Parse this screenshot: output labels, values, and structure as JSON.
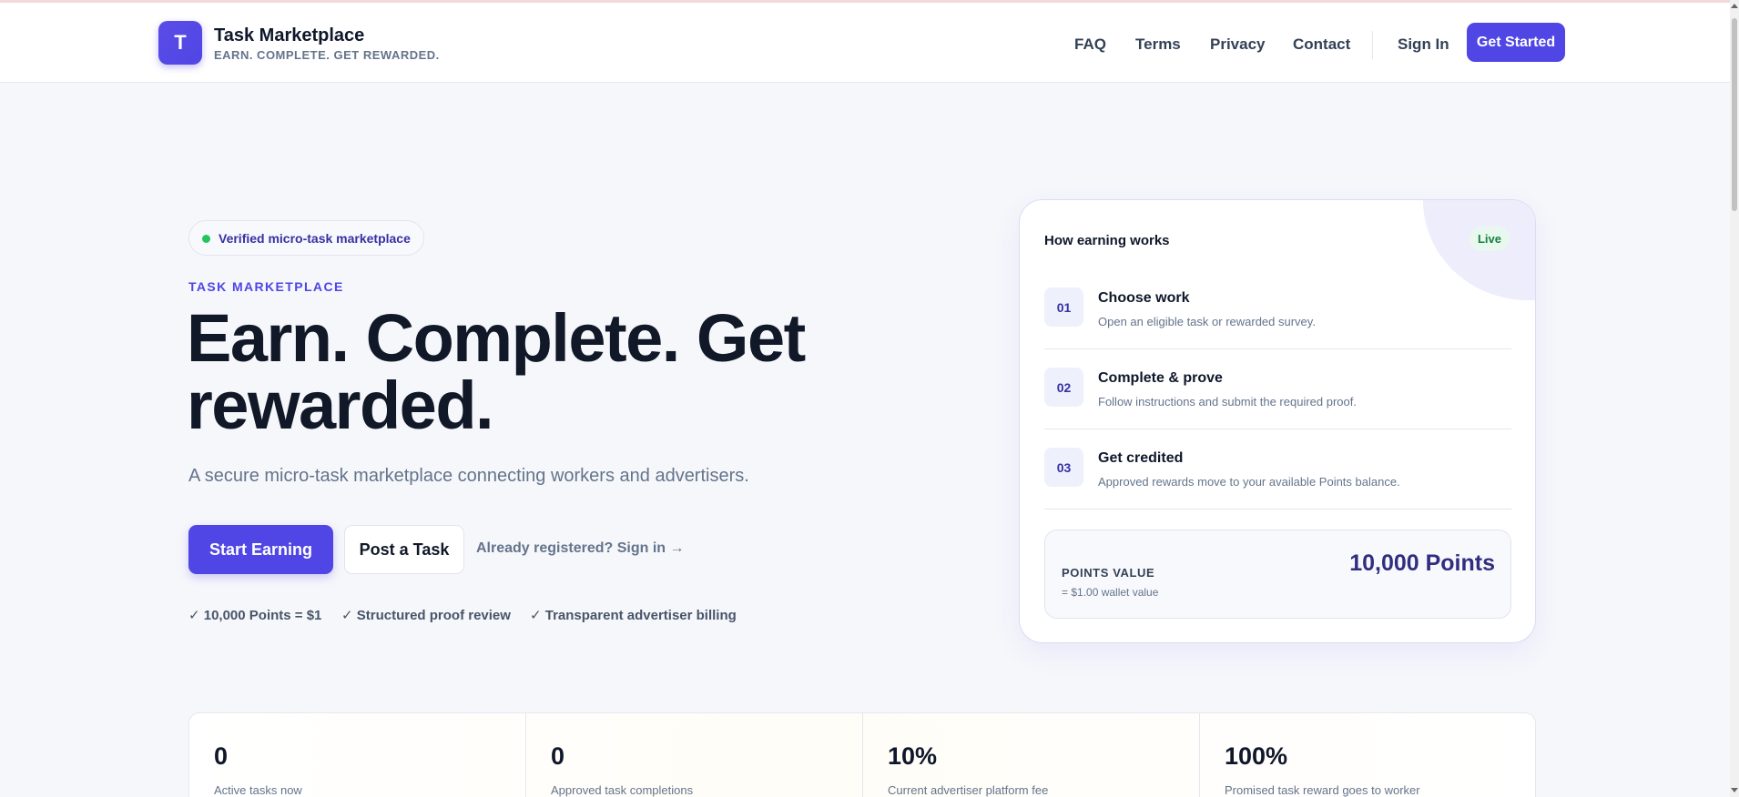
{
  "header": {
    "logo_letter": "T",
    "brand_name": "Task Marketplace",
    "brand_tagline": "EARN. COMPLETE. GET REWARDED.",
    "nav": [
      "FAQ",
      "Terms",
      "Privacy",
      "Contact"
    ],
    "sign_in": "Sign In",
    "get_started": "Get Started"
  },
  "hero": {
    "badge": "Verified micro-task marketplace",
    "eyebrow": "TASK MARKETPLACE",
    "title": "Earn. Complete. Get rewarded.",
    "subtitle": "A secure micro-task marketplace connecting workers and advertisers.",
    "primary_cta": "Start Earning",
    "secondary_cta": "Post a Task",
    "signin_link": "Already registered? Sign in →",
    "checks": [
      "✓ 10,000 Points = $1",
      "✓ Structured proof review",
      "✓ Transparent advertiser billing"
    ]
  },
  "card": {
    "title": "How earning works",
    "live": "Live",
    "steps": [
      {
        "num": "01",
        "title": "Choose work",
        "desc": "Open an eligible task or rewarded survey."
      },
      {
        "num": "02",
        "title": "Complete & prove",
        "desc": "Follow instructions and submit the required proof."
      },
      {
        "num": "03",
        "title": "Get credited",
        "desc": "Approved rewards move to your available Points balance."
      }
    ],
    "points_label": "POINTS VALUE",
    "points_sub": "= $1.00 wallet value",
    "points_value": "10,000 Points"
  },
  "stats": [
    {
      "value": "0",
      "label": "Active tasks now"
    },
    {
      "value": "0",
      "label": "Approved task completions"
    },
    {
      "value": "10%",
      "label": "Current advertiser platform fee"
    },
    {
      "value": "100%",
      "label": "Promised task reward goes to worker"
    }
  ],
  "colors": {
    "accent": "#4f46e5",
    "live_green": "#15803d",
    "badge_dot": "#22c55e"
  }
}
